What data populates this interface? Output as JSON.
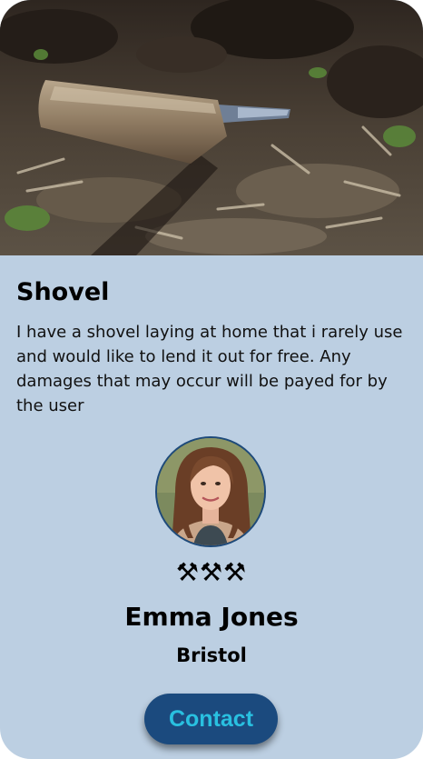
{
  "listing": {
    "title": "Shovel",
    "description": "I have a shovel laying at home that i rarely use and would like to lend it out for free. Any damages that may occur will be payed for by the user"
  },
  "owner": {
    "rating_icons": "⚒⚒⚒",
    "name": "Emma Jones",
    "location": "Bristol"
  },
  "actions": {
    "contact_label": "Contact"
  },
  "colors": {
    "card_background": "#bccfe2",
    "button_background": "#1b4a7e",
    "button_text": "#29c0e0"
  }
}
